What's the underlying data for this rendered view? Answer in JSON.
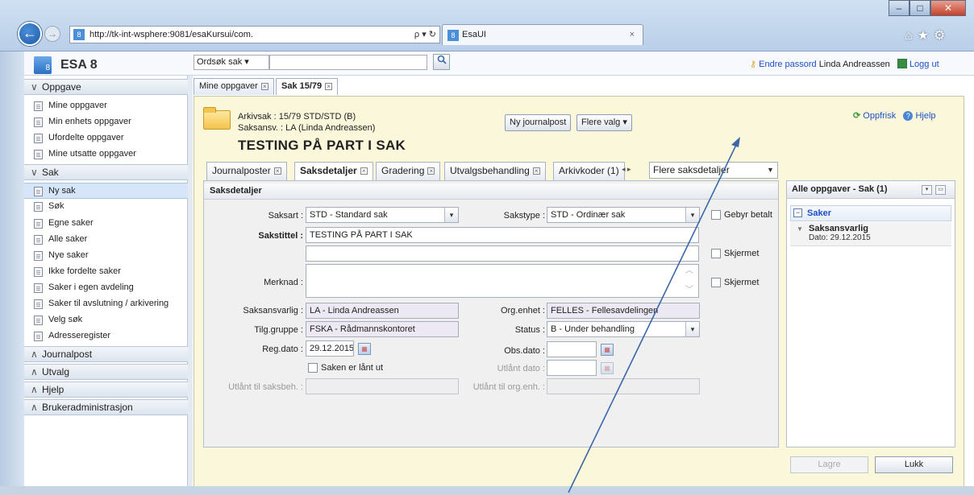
{
  "browser": {
    "url": "http://tk-int-wsphere:9081/esaKursui/com.",
    "url_host_bold": "tk-int-wsphere",
    "tab_title": "EsaUI",
    "back_glyph": "←",
    "fwd_glyph": "→",
    "url_controls": "ρ ▾ ↻",
    "tab_close": "×",
    "window_min": "–",
    "window_max": "□",
    "window_close": "✕",
    "right_icons": "⌂★⚙"
  },
  "app": {
    "title": "ESA 8",
    "logo_num": "8",
    "search_select": "Ordsøk sak ▾",
    "search_icon": "magnifier-icon",
    "change_password": "Endre passord",
    "user_name": "Linda Andreassen",
    "logout": "Logg ut"
  },
  "sidebar": {
    "sections": [
      {
        "label": "Oppgave",
        "chev": "∨"
      },
      {
        "label": "Sak",
        "chev": "∨"
      },
      {
        "label": "Journalpost",
        "chev": "∧"
      },
      {
        "label": "Utvalg",
        "chev": "∧"
      },
      {
        "label": "Hjelp",
        "chev": "∧"
      },
      {
        "label": "Brukeradministrasjon",
        "chev": "∧"
      }
    ],
    "oppgave_items": [
      "Mine oppgaver",
      "Min enhets oppgaver",
      "Ufordelte oppgaver",
      "Mine utsatte oppgaver"
    ],
    "sak_items": [
      "Ny sak",
      "Søk",
      "Egne saker",
      "Alle saker",
      "Nye saker",
      "Ikke fordelte saker",
      "Saker i egen avdeling",
      "Saker til avslutning / arkivering",
      "Velg søk",
      "Adresseregister"
    ],
    "selected": "Ny sak"
  },
  "main_tabs": [
    {
      "label": "Mine oppgaver",
      "active": false
    },
    {
      "label": "Sak 15/79",
      "active": true
    }
  ],
  "case": {
    "arkivsak_label": "Arkivsak :",
    "arkivsak_value": "15/79 STD/STD (B)",
    "saksansv_label": "Saksansv. :",
    "saksansv_value": "LA (Linda Andreassen)",
    "title": "TESTING PÅ PART I SAK",
    "btn_new_journal": "Ny journalpost",
    "btn_more": "Flere valg ▾",
    "refresh": "Oppfrisk",
    "help": "Hjelp"
  },
  "sub_tabs": [
    "Journalposter",
    "Saksdetaljer",
    "Gradering",
    "Utvalgsbehandling",
    "Arkivkoder (1)"
  ],
  "sub_tabs_active": "Saksdetaljer",
  "sub_tabs_nav": "◂ ▸",
  "more_details": "Flere saksdetaljer",
  "details": {
    "heading": "Saksdetaljer",
    "saksart_label": "Saksart :",
    "saksart_value": "STD - Standard sak",
    "sakstype_label": "Sakstype :",
    "sakstype_value": "STD - Ordinær sak",
    "gebyr_label": "Gebyr betalt",
    "sakstittel_label": "Sakstittel :",
    "sakstittel_value": "TESTING PÅ PART I SAK",
    "skjermet1": "Skjermet",
    "merknad_label": "Merknad :",
    "skjermet2": "Skjermet",
    "saksansvarlig_label": "Saksansvarlig :",
    "saksansvarlig_value": "LA - Linda  Andreassen",
    "orgenhet_label": "Org.enhet :",
    "orgenhet_value": "FELLES - Fellesavdelingen",
    "tilggruppe_label": "Tilg.gruppe :",
    "tilggruppe_value": "FSKA - Rådmannskontoret",
    "status_label": "Status :",
    "status_value": "B - Under behandling",
    "regdato_label": "Reg.dato :",
    "regdato_value": "29.12.2015",
    "obsdato_label": "Obs.dato :",
    "laant_label": "Saken er lånt ut",
    "utlant_dato_label": "Utlånt dato :",
    "utlant_saksbeh_label": "Utlånt til saksbeh. :",
    "utlant_orgenh_label": "Utlånt til org.enh. :"
  },
  "right_panel": {
    "title": "Alle oppgaver - Sak (1)",
    "group": "Saker",
    "item_title": "Saksansvarlig",
    "item_date": "Dato: 29.12.2015",
    "btn_save": "Lagre",
    "btn_close": "Lukk"
  }
}
